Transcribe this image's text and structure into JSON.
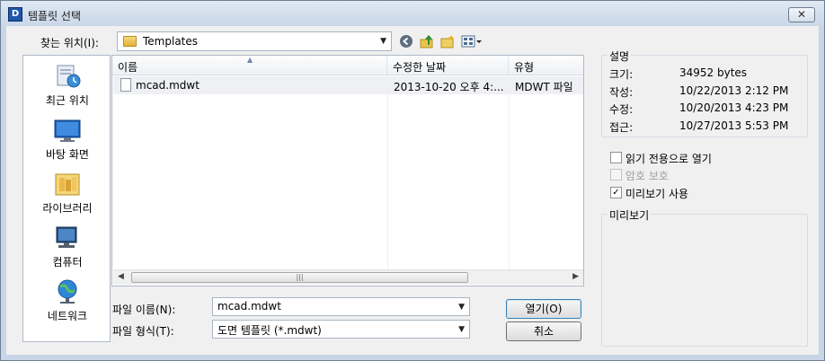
{
  "window": {
    "title": "템플릿 선택",
    "close_label": "✕"
  },
  "toolbar": {
    "look_in_label": "찾는 위치(I):",
    "look_in_value": "Templates",
    "icons": [
      "back-icon",
      "up-folder-icon",
      "new-folder-icon",
      "view-menu-icon"
    ]
  },
  "places": [
    {
      "label": "최근 위치",
      "icon": "recent-places-icon"
    },
    {
      "label": "바탕 화면",
      "icon": "desktop-icon"
    },
    {
      "label": "라이브러리",
      "icon": "libraries-icon"
    },
    {
      "label": "컴퓨터",
      "icon": "computer-icon"
    },
    {
      "label": "네트워크",
      "icon": "network-icon"
    }
  ],
  "file_list": {
    "columns": [
      "이름",
      "수정한 날짜",
      "유형"
    ],
    "rows": [
      {
        "name": "mcad.mdwt",
        "modified": "2013-10-20 오후 4:...",
        "type": "MDWT 파일"
      }
    ]
  },
  "file_name_label": "파일 이름(N):",
  "file_name_value": "mcad.mdwt",
  "file_type_label": "파일 형식(T):",
  "file_type_value": "도면 템플릿 (*.mdwt)",
  "buttons": {
    "open": "열기(O)",
    "cancel": "취소"
  },
  "description": {
    "title": "설명",
    "size_label": "크기:",
    "size_value": "34952 bytes",
    "created_label": "작성:",
    "created_value": "10/22/2013 2:12 PM",
    "modified_label": "수정:",
    "modified_value": "10/20/2013 4:23 PM",
    "accessed_label": "접근:",
    "accessed_value": "10/27/2013 5:53 PM"
  },
  "options": {
    "read_only": {
      "label": "읽기 전용으로 열기",
      "checked": false
    },
    "password": {
      "label": "암호 보호",
      "checked": false,
      "enabled": false
    },
    "preview": {
      "label": "미리보기 사용",
      "checked": true
    }
  },
  "preview": {
    "title": "미리보기"
  },
  "colors": {
    "window_frame": "#c8d6e7",
    "panel": "#f0f0f0",
    "selection": "#eef0f3"
  }
}
